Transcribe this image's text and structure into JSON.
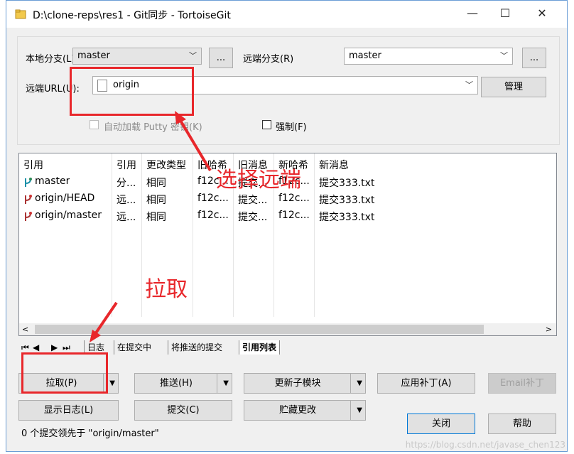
{
  "window": {
    "title": "D:\\clone-reps\\res1 - Git同步 - TortoiseGit",
    "minimize_glyph": "—",
    "maximize_glyph": "☐",
    "close_glyph": "✕"
  },
  "form": {
    "local_branch_label": "本地分支(L)",
    "local_branch_value": "master",
    "browse_label": "...",
    "remote_branch_label": "远端分支(R)",
    "remote_branch_value": "master",
    "remote_url_label": "远端URL(U):",
    "remote_url_value": "origin",
    "manage_label": "管理",
    "autoload_putty_label": "自动加载 Putty 密钥(K)",
    "force_label": "强制(F)"
  },
  "ref_table": {
    "headers": [
      "引用",
      "引用",
      "更改类型",
      "旧哈希",
      "旧消息",
      "新哈希",
      "新消息"
    ],
    "rows": [
      {
        "ref": "master",
        "type": "分...",
        "change": "相同",
        "old_hash": "f12c...",
        "old_msg": "提交...",
        "new_hash": "f12c...",
        "new_msg": "提交333.txt",
        "icon": "branch-icon"
      },
      {
        "ref": "origin/HEAD",
        "type": "远...",
        "change": "相同",
        "old_hash": "f12c...",
        "old_msg": "提交...",
        "new_hash": "f12c...",
        "new_msg": "提交333.txt",
        "icon": "remote-branch-icon"
      },
      {
        "ref": "origin/master",
        "type": "远...",
        "change": "相同",
        "old_hash": "f12c...",
        "old_msg": "提交...",
        "new_hash": "f12c...",
        "new_msg": "提交333.txt",
        "icon": "remote-branch-icon"
      }
    ]
  },
  "tabs": {
    "items": [
      "日志",
      "在提交中",
      "将推送的提交",
      "引用列表"
    ],
    "active": "引用列表",
    "nav_glyphs": [
      "⏮",
      "◀",
      "▶",
      "⏭"
    ]
  },
  "buttons": {
    "pull": "拉取(P)",
    "push": "推送(H)",
    "update_submodules": "更新子模块",
    "apply_patch": "应用补丁(A)",
    "email_patch": "Email补丁",
    "show_log": "显示日志(L)",
    "commit": "提交(C)",
    "stash": "贮藏更改",
    "close": "关闭",
    "help": "帮助"
  },
  "status": {
    "text": "0 个提交领先于 \"origin/master\""
  },
  "annotations": {
    "select_remote": "选择远端",
    "pull": "拉取",
    "color": "#e8272b"
  },
  "watermark": "https://blog.csdn.net/javase_chen123"
}
